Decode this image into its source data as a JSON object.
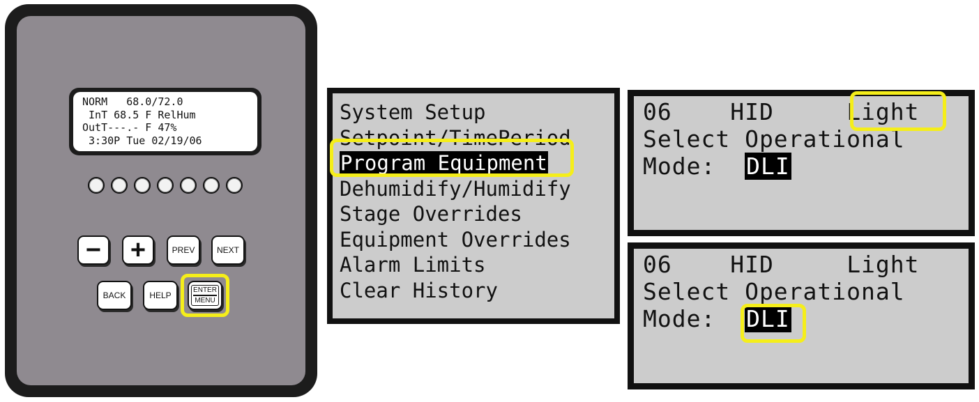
{
  "controller": {
    "lcd_lines": [
      "NORM   68.0/72.0",
      " InT 68.5 F RelHum",
      "OutT---.- F 47%",
      " 3:30P Tue 02/19/06"
    ],
    "keys": {
      "minus": "−",
      "plus": "+",
      "prev": "PREV",
      "next": "NEXT",
      "back": "BACK",
      "help": "HELP",
      "enter_top": "ENTER",
      "enter_bottom": "MENU"
    }
  },
  "menu": {
    "items": [
      "System Setup",
      "Setpoint/TimePeriod",
      "Program Equipment",
      "Dehumidify/Humidify",
      "Stage Overrides",
      "Equipment Overrides",
      "Alarm Limits",
      "Clear History"
    ],
    "selected": "Program Equipment"
  },
  "mode_screen_1": {
    "number": "06",
    "type": "HID",
    "equipment": "Light",
    "line2": "Select Operational",
    "mode_label": "Mode:",
    "mode_value": "DLI"
  },
  "mode_screen_2": {
    "number": "06",
    "type": "HID",
    "equipment": "Light",
    "line2": "Select Operational",
    "mode_label": "Mode:",
    "mode_value": "DLI"
  },
  "colors": {
    "highlight": "#f5ee1a",
    "device_body": "#8f8a90",
    "screen_bg": "#cccccc"
  }
}
